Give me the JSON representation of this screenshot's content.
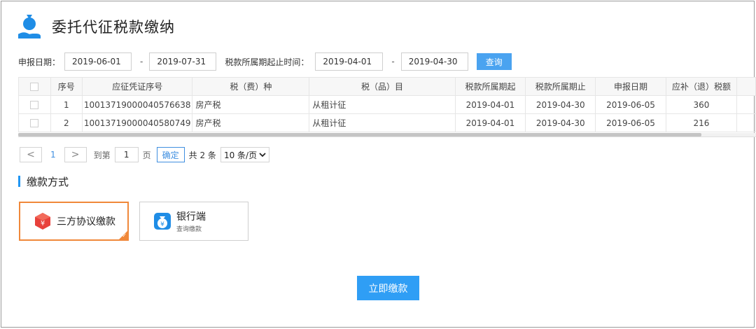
{
  "header": {
    "title": "委托代征税款缴纳",
    "icon": "money-bag-hand-icon"
  },
  "filter": {
    "report_date_label": "申报日期：",
    "report_date_from": "2019-06-01",
    "report_date_to": "2019-07-31",
    "separator": "-",
    "period_label": "税款所属期起止时间：",
    "period_from": "2019-04-01",
    "period_to": "2019-04-30",
    "query_label": "查询"
  },
  "table": {
    "headers": [
      "",
      "序号",
      "应征凭证序号",
      "税（费）种",
      "税（品）目",
      "税款所属期起",
      "税款所属期止",
      "申报日期",
      "应补（退）税额",
      ""
    ],
    "rows": [
      [
        "",
        "1",
        "10013719000040576638",
        "房产税",
        "从租计征",
        "2019-04-01",
        "2019-04-30",
        "2019-06-05",
        "360",
        ""
      ],
      [
        "",
        "2",
        "10013719000040580749",
        "房产税",
        "从租计征",
        "2019-04-01",
        "2019-04-30",
        "2019-06-05",
        "216",
        ""
      ]
    ]
  },
  "pager": {
    "prev": "<",
    "current_page": "1",
    "next": ">",
    "goto_label": "到第",
    "goto_value": "1",
    "page_unit": "页",
    "confirm_label": "确定",
    "total_label": "共 2 条",
    "page_size": "10 条/页"
  },
  "payment": {
    "section_title": "缴款方式",
    "options": [
      {
        "label": "三方协议缴款",
        "sub": "",
        "icon": "yuan-box-icon",
        "selected": true
      },
      {
        "label": "银行端",
        "sub": "查询缴款",
        "icon": "yuan-bag-icon",
        "selected": false
      }
    ]
  },
  "submit_label": "立即缴款",
  "colors": {
    "primary": "#2f9ef5",
    "selected_border": "#f0883a",
    "icon_red": "#e8413b"
  }
}
